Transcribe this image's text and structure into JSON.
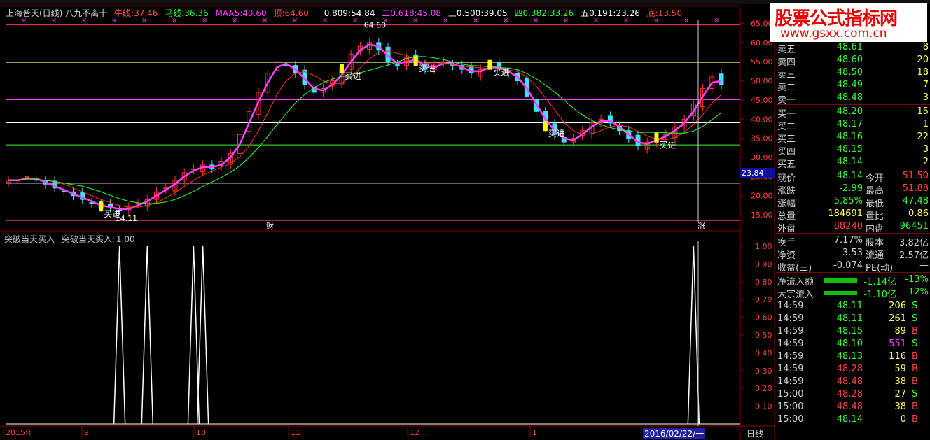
{
  "header": {
    "title": "上海普天(日线) 八九不离十",
    "niu_label": "牛线:",
    "niu_value": "37.46",
    "ma_label": "马线:",
    "ma_value": "36.36",
    "maa5_label": "MAA5:",
    "maa5_value": "40.60",
    "top_label": "顶:",
    "top_value": "64.60",
    "f1_label": "一0.809:",
    "f1_value": "54.84",
    "f2_label": "二0.618:",
    "f2_value": "45.08",
    "f3_label": "三0.500:",
    "f3_value": "39.05",
    "f4_label": "四0.382:",
    "f4_value": "33.26",
    "f5_label": "五0.191:",
    "f5_value": "23.26",
    "bottom_label": "底:",
    "bottom_value": "13.50"
  },
  "sub_header": {
    "name": "突破当天买入",
    "label": "突破当天买入:",
    "value": "1.00"
  },
  "watermark": {
    "title": "股票公式指标网",
    "url": "www.gsxx.com.cn"
  },
  "chart_annotations": {
    "high_label": "64.60",
    "low_label": "14.11",
    "buy_label": "买进",
    "cai_marker": "财",
    "zhang_marker": "涨",
    "price_tag": "23.84"
  },
  "price_axis": [
    "65.00",
    "60.00",
    "55.00",
    "50.00",
    "45.00",
    "40.00",
    "35.00",
    "30.00",
    "25.00",
    "20.00",
    "15.00"
  ],
  "indicator_axis": [
    "1.00",
    "0.90",
    "0.80",
    "0.70",
    "0.60",
    "0.50",
    "0.40",
    "0.30",
    "0.20",
    "0.10"
  ],
  "time_axis": [
    "2015年",
    "9",
    "10",
    "11",
    "12",
    "1"
  ],
  "date_tag": "2016/02/22/一",
  "period_button": "日线",
  "quotes": {
    "asks": [
      {
        "label": "卖五",
        "price": "48.61",
        "vol": "8"
      },
      {
        "label": "卖四",
        "price": "48.60",
        "vol": "20"
      },
      {
        "label": "卖三",
        "price": "48.50",
        "vol": "18"
      },
      {
        "label": "卖二",
        "price": "48.49",
        "vol": "7"
      },
      {
        "label": "卖一",
        "price": "48.48",
        "vol": "3"
      }
    ],
    "bids": [
      {
        "label": "买一",
        "price": "48.20",
        "vol": "15"
      },
      {
        "label": "买二",
        "price": "48.17",
        "vol": "1"
      },
      {
        "label": "买三",
        "price": "48.16",
        "vol": "22"
      },
      {
        "label": "买四",
        "price": "48.15",
        "vol": "3"
      },
      {
        "label": "买五",
        "price": "48.14",
        "vol": "2"
      }
    ]
  },
  "stats": [
    {
      "l1": "现价",
      "v1": "48.14",
      "l2": "今开",
      "v2": "51.50"
    },
    {
      "l1": "涨跌",
      "v1": "-2.99",
      "l2": "最高",
      "v2": "51.88"
    },
    {
      "l1": "涨幅",
      "v1": "-5.85%",
      "l2": "最低",
      "v2": "47.48"
    },
    {
      "l1": "总量",
      "v1": "184691",
      "l2": "量比",
      "v2": "0.86"
    },
    {
      "l1": "外盘",
      "v1": "88240",
      "l2": "内盘",
      "v2": "96451"
    }
  ],
  "fundamentals": [
    {
      "l1": "换手",
      "v1": "7.17%",
      "l2": "股本",
      "v2": "3.82亿"
    },
    {
      "l1": "净资",
      "v1": "3.53",
      "l2": "流通",
      "v2": "2.57亿"
    },
    {
      "l1": "收益(三)",
      "v1": "-0.074",
      "l2": "PE(动)",
      "v2": "—"
    }
  ],
  "flows": [
    {
      "label": "净流入额",
      "amount": "-1.14亿",
      "pct": "-13%"
    },
    {
      "label": "大宗流入",
      "amount": "-1.10亿",
      "pct": "-12%"
    }
  ],
  "ticks": [
    {
      "time": "14:59",
      "price": "48.11",
      "vol": "206",
      "side": "S"
    },
    {
      "time": "14:59",
      "price": "48.11",
      "vol": "261",
      "side": "S"
    },
    {
      "time": "14:59",
      "price": "48.15",
      "vol": "89",
      "side": "B"
    },
    {
      "time": "14:59",
      "price": "48.10",
      "vol": "551",
      "side": "S"
    },
    {
      "time": "14:59",
      "price": "48.13",
      "vol": "116",
      "side": "B"
    },
    {
      "time": "14:59",
      "price": "48.28",
      "vol": "59",
      "side": "B"
    },
    {
      "time": "14:59",
      "price": "48.48",
      "vol": "38",
      "side": "B"
    },
    {
      "time": "15:00",
      "price": "48.28",
      "vol": "27",
      "side": "S"
    },
    {
      "time": "15:00",
      "price": "48.48",
      "vol": "38",
      "side": "B"
    },
    {
      "time": "15:00",
      "price": "48.14",
      "vol": "0",
      "side": "B"
    }
  ],
  "chart_data": {
    "type": "line",
    "price_levels": [
      64.6,
      54.84,
      45.08,
      39.05,
      33.26,
      23.26,
      13.5
    ],
    "price_ylim": [
      13,
      66
    ],
    "closes": [
      24,
      24,
      25,
      24,
      23,
      22,
      21,
      20,
      19,
      18,
      17,
      17,
      16,
      17,
      18,
      19,
      21,
      22,
      24,
      26,
      27,
      28,
      27,
      29,
      31,
      36,
      42,
      47,
      52,
      55,
      54,
      52,
      49,
      47,
      48,
      50,
      53,
      57,
      59,
      60,
      58,
      55,
      54,
      56,
      55,
      53,
      54,
      55,
      54,
      53,
      52,
      53,
      54,
      53,
      52,
      50,
      46,
      42,
      38,
      36,
      34,
      35,
      37,
      39,
      40,
      39,
      37,
      35,
      33,
      34,
      35,
      36,
      38,
      40,
      44,
      48,
      51,
      49
    ],
    "indicator_ylim": [
      0,
      1
    ],
    "signal_bar_indices": [
      12,
      15,
      20,
      21,
      74
    ]
  }
}
